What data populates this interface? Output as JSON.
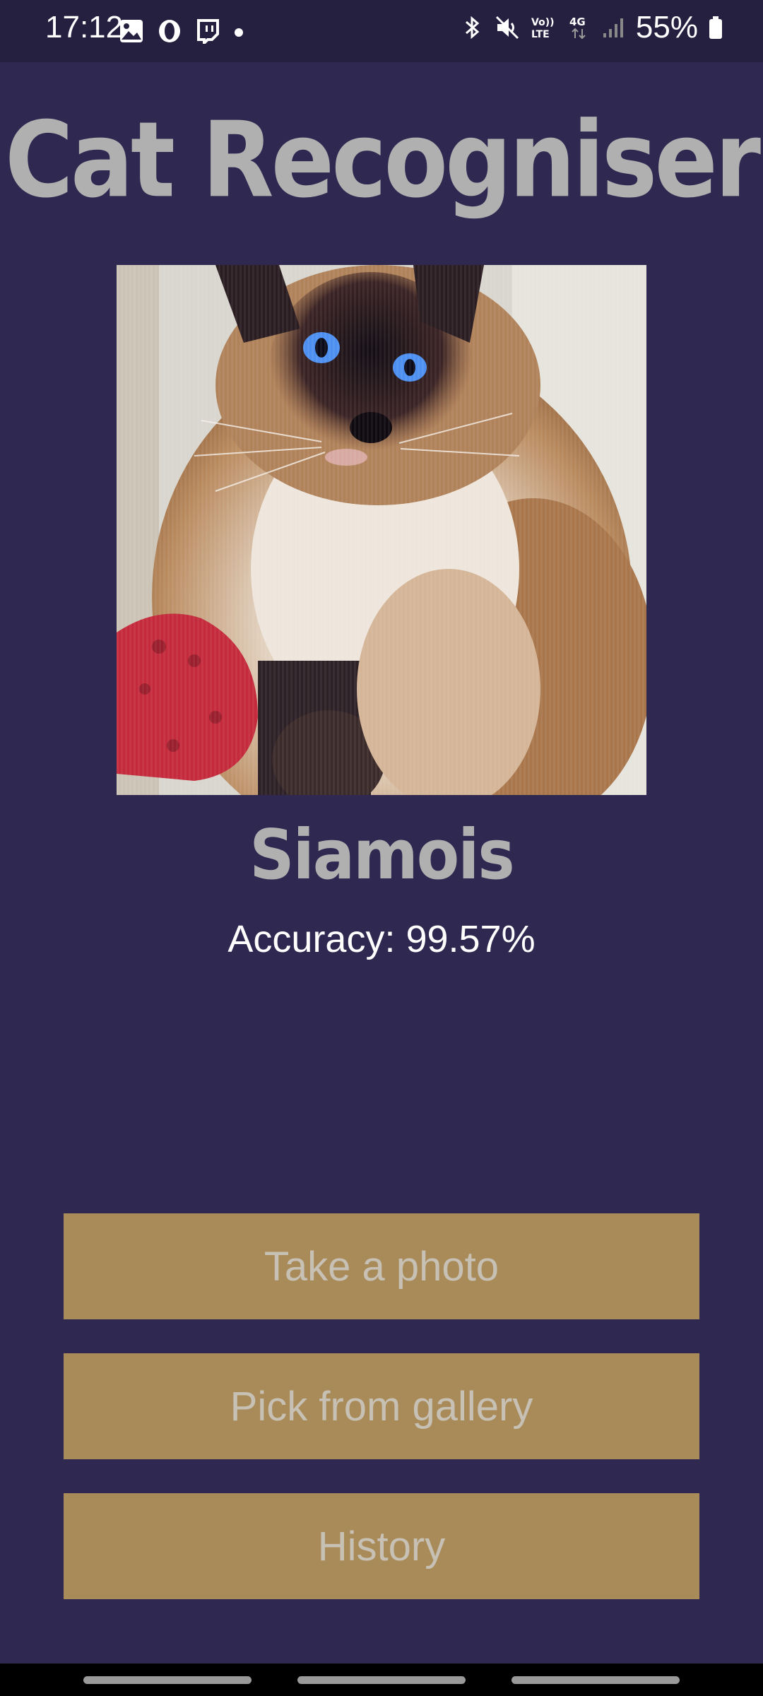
{
  "status_bar": {
    "time": "17:12",
    "battery_percent": "55%",
    "left_icons": [
      "gallery-icon",
      "opera-icon",
      "twitch-icon",
      "dot-icon"
    ],
    "right_icons": [
      "bluetooth-icon",
      "mute-icon",
      "volte-icon",
      "4g-icon",
      "signal-icon",
      "battery-icon"
    ],
    "volte_label": "Vo)) LTE",
    "network_label": "4G"
  },
  "app": {
    "title": "Cat Recogniser",
    "breed": "Siamois",
    "accuracy": "Accuracy: 99.57%"
  },
  "buttons": {
    "take_photo": "Take a photo",
    "pick_gallery": "Pick from gallery",
    "history": "History"
  },
  "colors": {
    "background": "#2f2850",
    "button": "#a98b5a",
    "title": "#b0b0b0"
  }
}
